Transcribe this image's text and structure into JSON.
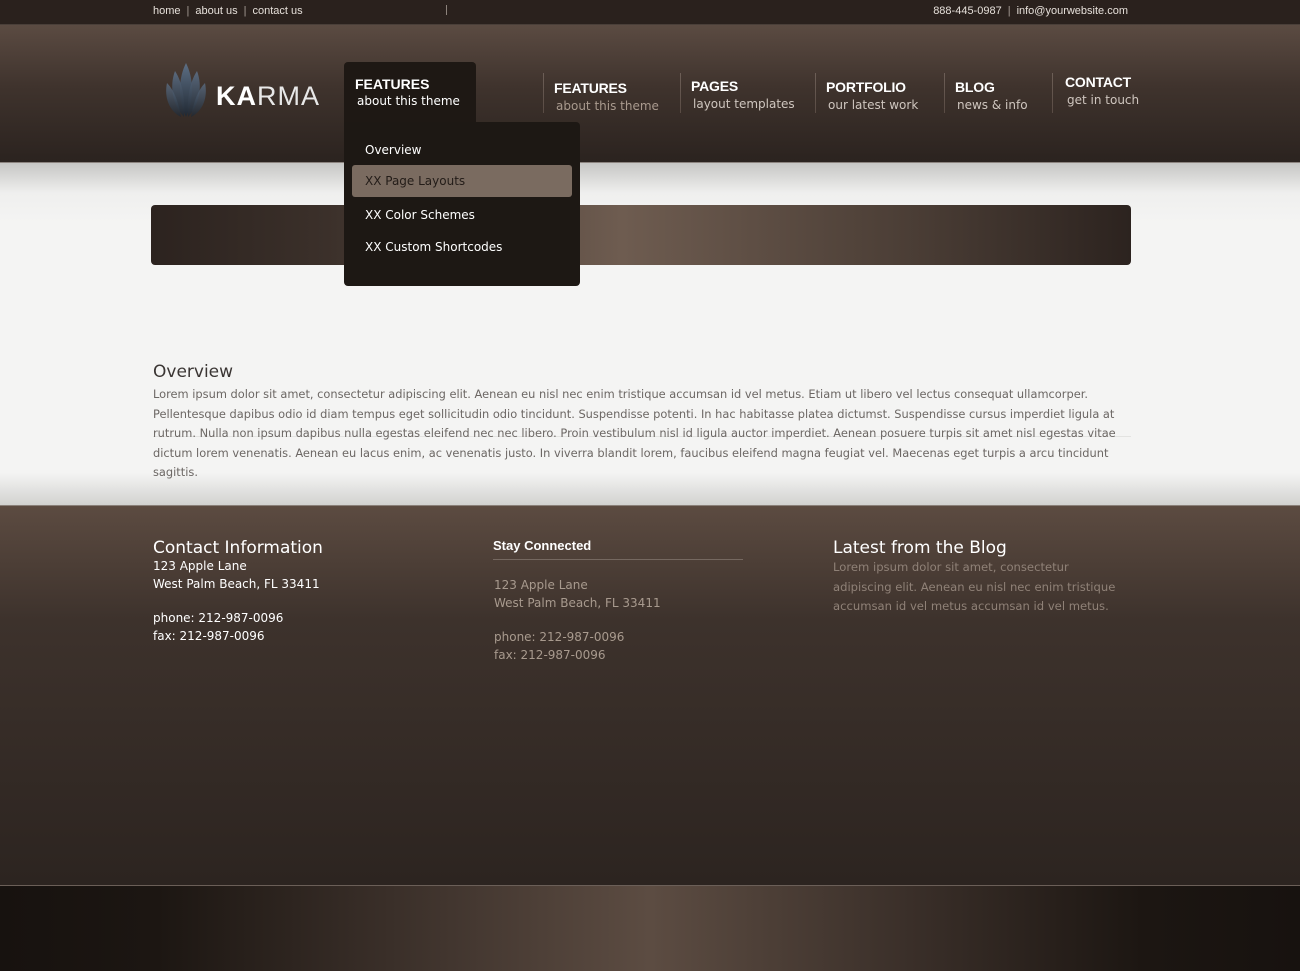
{
  "topbar": {
    "links": [
      "home",
      "about us",
      "contact us"
    ],
    "phone": "888-445-0987",
    "email": "info@yourwebsite.com",
    "separator": "|"
  },
  "logo": {
    "bold": "KA",
    "thin": "RMA"
  },
  "nav": {
    "active": {
      "title": "FEATURES",
      "subtitle": "about this theme"
    },
    "items": [
      {
        "title": "FEATURES",
        "subtitle": "about this theme"
      },
      {
        "title": "PAGES",
        "subtitle": "layout templates"
      },
      {
        "title": "PORTFOLIO",
        "subtitle": "our latest work"
      },
      {
        "title": "BLOG",
        "subtitle": "news & info"
      },
      {
        "title": "CONTACT",
        "subtitle": "get in touch"
      }
    ]
  },
  "dropdown": {
    "items": [
      "Overview",
      "XX Page Layouts",
      "XX Color Schemes",
      "XX Custom Shortcodes"
    ],
    "hovered_index": 1
  },
  "content": {
    "heading": "Overview",
    "body": "Lorem ipsum dolor sit amet, consectetur adipiscing elit. Aenean eu nisl nec enim tristique accumsan id vel metus. Etiam ut libero vel lectus consequat ullamcorper. Pellentesque dapibus odio id diam tempus eget sollicitudin odio tincidunt. Suspendisse potenti. In hac habitasse platea dictumst. Suspendisse cursus imperdiet ligula at rutrum. Nulla non ipsum dapibus nulla egestas eleifend nec nec libero. Proin vestibulum nisl id ligula auctor imperdiet. Aenean posuere turpis sit amet nisl egestas vitae dictum lorem venenatis. Aenean eu lacus enim, ac venenatis justo. In viverra blandit lorem, faucibus eleifend magna feugiat vel. Maecenas eget turpis a arcu tincidunt sagittis."
  },
  "footer": {
    "contact": {
      "heading": "Contact Information",
      "address1": "123 Apple Lane",
      "address2": "West Palm Beach, FL 33411",
      "phone": "phone: 212-987-0096",
      "fax": "fax: 212-987-0096"
    },
    "stay": {
      "heading": "Stay Connected",
      "address1": "123 Apple Lane",
      "address2": "West Palm Beach, FL 33411",
      "phone": "phone: 212-987-0096",
      "fax": "fax: 212-987-0096"
    },
    "blog": {
      "heading": "Latest from the Blog",
      "text": "Lorem ipsum dolor sit amet, consectetur adipiscing elit. Aenean eu nisl nec enim tristique accumsan id vel metus accumsan id vel metus."
    }
  },
  "colors": {
    "header_dark": "#2a211d",
    "accent_brown": "#7a6b60",
    "footer_muted_text": "#a89a8e"
  },
  "icons": {
    "logo_mark": "leaf-crest-icon"
  }
}
